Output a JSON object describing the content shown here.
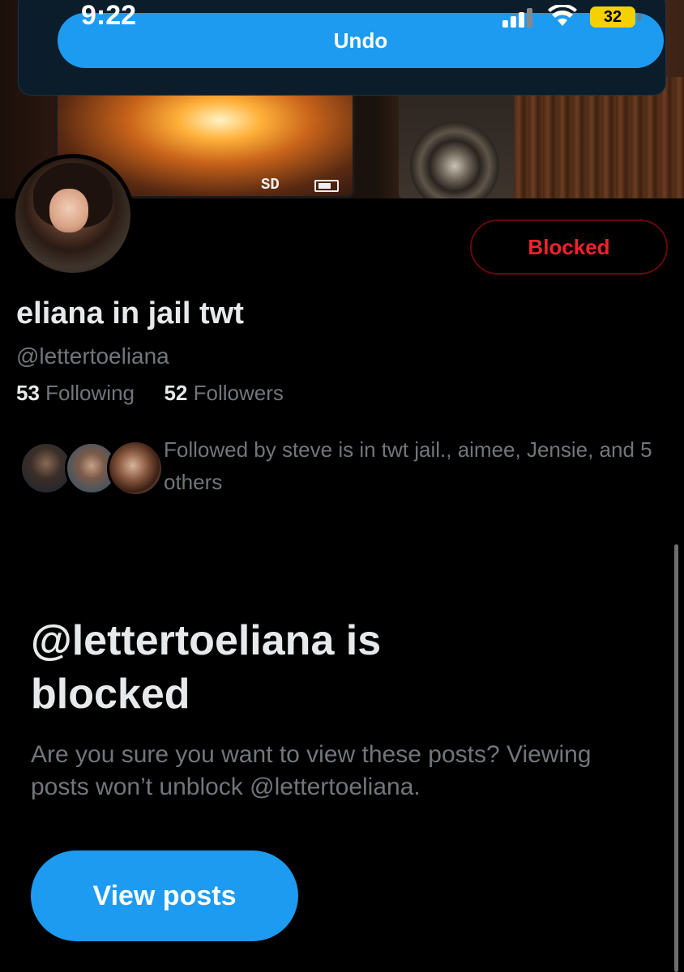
{
  "status_bar": {
    "time": "9:22",
    "battery_level": "32",
    "icons": [
      "signal-icon",
      "wifi-icon",
      "battery-icon"
    ]
  },
  "toast": {
    "undo_label": "Undo"
  },
  "banner": {
    "camera_screen_labels": [
      "SD"
    ]
  },
  "profile": {
    "display_name": "eliana in jail twt",
    "handle": "@lettertoeliana",
    "following_count": "53",
    "following_label": "Following",
    "followers_count": "52",
    "followers_label": "Followers",
    "blocked_button_label": "Blocked",
    "followed_by_text": "Followed by steve is in twt jail., aimee, Jensie, and 5 others"
  },
  "blocked_notice": {
    "title": "@lettertoeliana is blocked",
    "description": "Are you sure you want to view these posts? Viewing posts won’t unblock @lettertoeliana.",
    "view_posts_label": "View posts"
  },
  "colors": {
    "accent_blue": "#1d9bf0",
    "blocked_red": "#f4212e",
    "muted_text": "#71767b",
    "primary_text": "#e7e9ea",
    "background": "#000000"
  }
}
